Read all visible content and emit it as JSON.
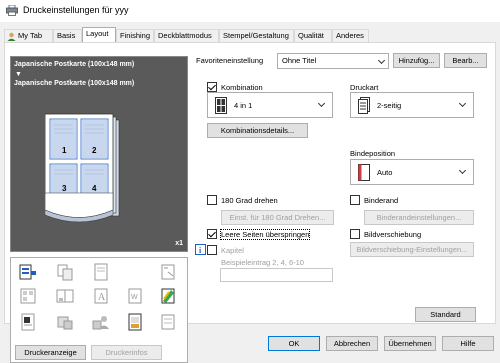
{
  "window": {
    "title": "Druckeinstellungen für yyy"
  },
  "tabs": [
    {
      "label": "My Tab"
    },
    {
      "label": "Basis"
    },
    {
      "label": "Layout"
    },
    {
      "label": "Finishing"
    },
    {
      "label": "Deckblattmodus"
    },
    {
      "label": "Stempel/Gestaltung"
    },
    {
      "label": "Qualität"
    },
    {
      "label": "Anderes"
    }
  ],
  "favorites": {
    "label": "Favoriteneinstellung",
    "value": "Ohne Titel",
    "add_button": "Hinzufüg...",
    "edit_button": "Bearb..."
  },
  "preview": {
    "paper_line1": "Japanische Postkarte (100x148 mm)",
    "paper_line2": "Japanische Postkarte (100x148 mm)",
    "copies": "x1",
    "page_numbers": [
      "1",
      "2",
      "3",
      "4"
    ]
  },
  "left_buttons": {
    "printer_view": "Druckeranzeige",
    "printer_info": "Druckerinfos"
  },
  "combination": {
    "label": "Kombination",
    "checked": true,
    "value": "4 in 1",
    "details_button": "Kombinationsdetails..."
  },
  "print_type": {
    "label": "Druckart",
    "value": "2-seitig"
  },
  "binding_position": {
    "label": "Bindeposition",
    "value": "Auto"
  },
  "rotate": {
    "label": "180 Grad drehen",
    "checked": false,
    "button": "Einst. für 180 Grad Drehen..."
  },
  "skip_blank": {
    "label": "Leere Seiten überspringen",
    "checked": true
  },
  "chapter": {
    "label": "Kapitel",
    "checked": false,
    "hint": "Beispieleintrag 2, 4, 6-10",
    "value": ""
  },
  "binding_margin": {
    "label": "Binderand",
    "checked": false,
    "button": "Binderandeinstellungen..."
  },
  "image_shift": {
    "label": "Bildverschiebung",
    "checked": false,
    "button": "Bildverschiebung-Einstellungen..."
  },
  "standard_button": "Standard",
  "dialog_buttons": {
    "ok": "OK",
    "cancel": "Abbrechen",
    "apply": "Übernehmen",
    "help": "Hilfe"
  },
  "colors": {
    "preview_bg": "#5a5a5a",
    "focus_blue": "#0078d7",
    "page_blue": "#1f5fbf"
  }
}
